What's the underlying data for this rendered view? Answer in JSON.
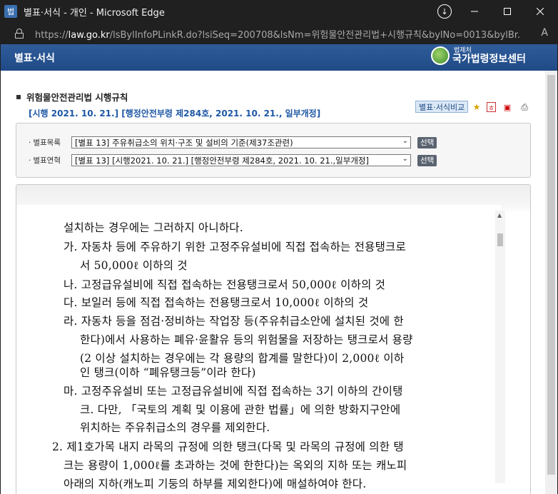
{
  "browser": {
    "app_icon": "법",
    "title": "별표·서식 - 개인 - Microsoft Edge",
    "url_prefix": "https://",
    "url_host": "law.go.kr",
    "url_rest": "/lsBylInfoPLinkR.do?lsiSeq=200708&lsNm=위험물안전관리법+시행규칙&bylNo=0013&bylBr...",
    "read_aloud_label": "A"
  },
  "header": {
    "title": "별표·서식",
    "logo_small": "법제처",
    "logo_big": "국가법령정보센터"
  },
  "law": {
    "name": "위험물안전관리법 시행규칙",
    "info": "[시행 2021. 10. 21.] [행정안전부령 제284호, 2021. 10. 21., 일부개정]",
    "compare_label": "별표·서식비교"
  },
  "selects": {
    "list_label": "별표목록",
    "list_value": "[별표 13] 주유취급소의 위치·구조 및 설비의 기준(제37조관련)",
    "history_label": "별표연혁",
    "history_value": "[별표 13] [시행2021. 10. 21.] [행정안전부령 제284호, 2021. 10. 21.,일부개정]",
    "select_btn": "선택"
  },
  "document": {
    "lines": [
      "설치하는 경우에는 그러하지 아니하다.",
      "가. 자동차 등에 주유하기 위한 고정주유설비에 직접 접속하는 전용탱크로",
      "서 50,000ℓ 이하의 것",
      "나. 고정급유설비에 직접 접속하는 전용탱크로서 50,000ℓ 이하의 것",
      "다. 보일러 등에 직접 접속하는 전용탱크로서 10,000ℓ 이하의 것",
      "라. 자동차 등을 점검·정비하는 작업장 등(주유취급소안에 설치된 것에 한",
      "한다)에서 사용하는 폐유·윤활유 등의 위험물을 저장하는 탱크로서 용량",
      "(2 이상 설치하는 경우에는 각 용량의 합계를 말한다)이 2,000ℓ 이하",
      "인 탱크(이하 “폐유탱크등”이라 한다)",
      "마. 고정주유설비 또는 고정급유설비에 직접 접속하는 3기 이하의 간이탱",
      "크. 다만, 「국토의 계획 및 이용에 관한 법률」에 의한 방화지구안에",
      "위치하는 주유취급소의 경우를 제외한다.",
      "2. 제1호가목 내지 라목의 규정에 의한 탱크(다목 및 라목의 규정에 의한 탱",
      "크는 용량이 1,000ℓ를 초과하는 것에 한한다)는 옥외의 지하 또는 캐노피",
      "아래의 지하(캐노피 기둥의 하부를 제외한다)에 매설하여야 한다."
    ]
  }
}
